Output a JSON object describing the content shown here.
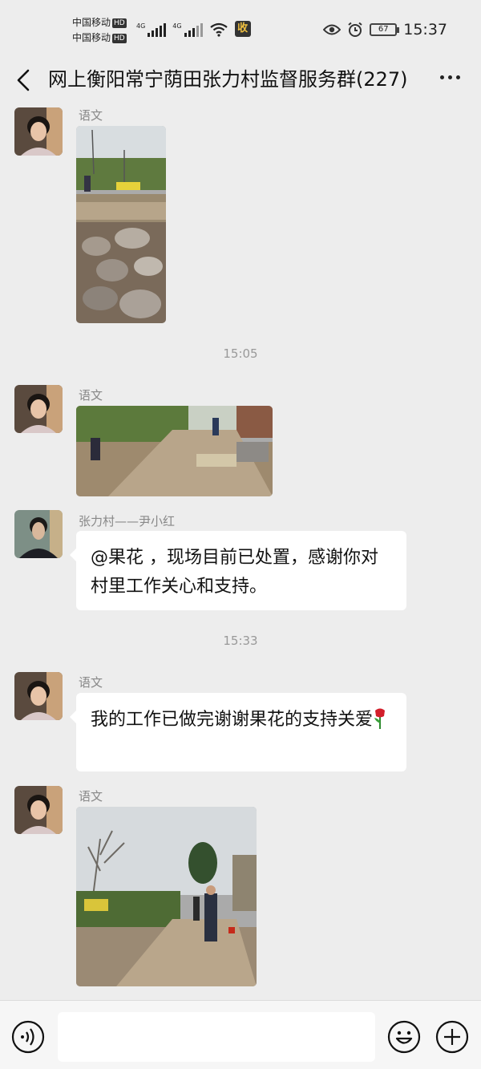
{
  "status_bar": {
    "carrier_1": "中国移动",
    "carrier_2": "中国移动",
    "hd_badge": "HD",
    "network_1": "4G",
    "network_2": "4G",
    "app_badge": "收",
    "battery": "67",
    "time": "15:37"
  },
  "header": {
    "title": "网上衡阳常宁荫田张力村监督服务群(227)"
  },
  "messages": [
    {
      "sender": "语文",
      "type": "image"
    },
    {
      "type": "timestamp",
      "text": "15:05"
    },
    {
      "sender": "语文",
      "type": "image"
    },
    {
      "sender": "张力村——尹小红",
      "type": "text",
      "text": "@果花 ，现场目前已处置，感谢你对村里工作关心和支持。"
    },
    {
      "type": "timestamp",
      "text": "15:33"
    },
    {
      "sender": "语文",
      "type": "text",
      "text": "我的工作已做完谢谢果花的支持关爱"
    },
    {
      "sender": "语文",
      "type": "image"
    }
  ],
  "input_bar": {
    "placeholder": ""
  }
}
